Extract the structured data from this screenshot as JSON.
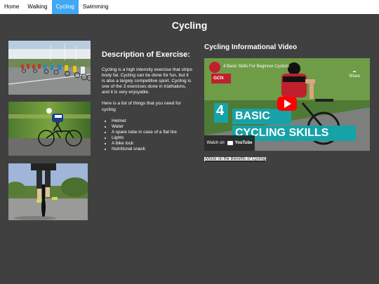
{
  "nav": {
    "items": [
      {
        "label": "Home",
        "active": false
      },
      {
        "label": "Walking",
        "active": false
      },
      {
        "label": "Cycling",
        "active": true
      },
      {
        "label": "Swimming",
        "active": false
      }
    ],
    "active_color": "#3fa9f5"
  },
  "page": {
    "title": "Cycling",
    "background": "#404040"
  },
  "description": {
    "heading": "Description of Exercise:",
    "paragraph1": "Cycling is a high intensity exercise that strips body fat. Cycling can be done for fun, but it is also a largely competitive sport. Cycling is one of the 3 exercises done in triathalons, and it is very enjoyable.",
    "paragraph2": "Here is a list of things that you need for cycling",
    "items": [
      "Helmet",
      "Water",
      "A spare tube in case of a flat tire",
      "Lights",
      "A bike lock",
      "Nutritional snack"
    ]
  },
  "video": {
    "section_title": "Cycling Informational Video",
    "title": "4 Basic Skills For Beginner Cyclists",
    "share_label": "Share",
    "thumb_number": "4",
    "thumb_line1": "BASIC",
    "thumb_line2": "CYCLING SKILLS",
    "channel": "GCN",
    "watch_on": "Watch on",
    "youtube": "YouTube"
  },
  "article": {
    "link_text": "Article on the Benefits of Cycling"
  },
  "images": [
    {
      "name": "peloton-photo-icon"
    },
    {
      "name": "cyclist-motion-photo-icon"
    },
    {
      "name": "cyclist-front-photo-icon"
    }
  ]
}
